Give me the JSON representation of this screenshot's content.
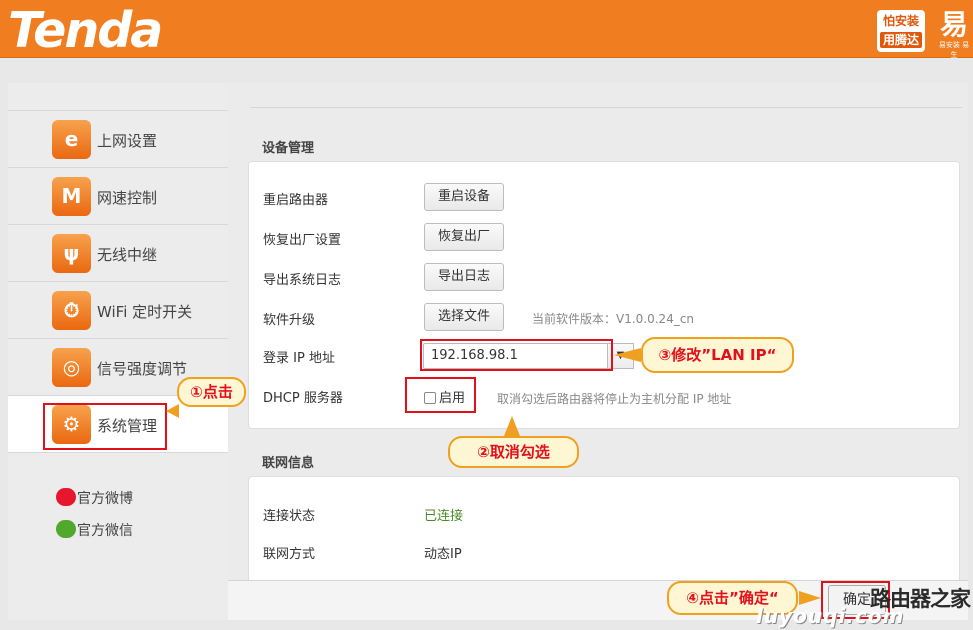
{
  "brand": {
    "logo": "Tenda",
    "stamp_line1": "怕安装",
    "stamp_line2": "用腾达",
    "easy_mark": "易",
    "easy_caption": "易安装 易生"
  },
  "sidebar": {
    "items": [
      {
        "label": "上网设置",
        "icon": "internet-e-icon",
        "glyph": "e"
      },
      {
        "label": "网速控制",
        "icon": "speed-wave-icon",
        "glyph": "M"
      },
      {
        "label": "无线中继",
        "icon": "wireless-relay-icon",
        "glyph": "ψ"
      },
      {
        "label": "WiFi 定时开关",
        "icon": "wifi-timer-icon",
        "glyph": "⏱"
      },
      {
        "label": "信号强度调节",
        "icon": "signal-strength-icon",
        "glyph": "◎"
      },
      {
        "label": "系统管理",
        "icon": "gear-icon",
        "glyph": "⚙"
      }
    ],
    "active_index": 5,
    "weibo": "官方微博",
    "wechat": "官方微信"
  },
  "device_mgmt": {
    "title": "设备管理",
    "reboot_label": "重启路由器",
    "reboot_button": "重启设备",
    "restore_label": "恢复出厂设置",
    "restore_button": "恢复出厂",
    "export_label": "导出系统日志",
    "export_button": "导出日志",
    "upgrade_label": "软件升级",
    "upgrade_button": "选择文件",
    "firmware_hint": "当前软件版本：V1.0.0.24_cn",
    "login_ip_label": "登录 IP 地址",
    "login_ip_value": "192.168.98.1",
    "dhcp_label": "DHCP 服务器",
    "dhcp_checkbox": "启用",
    "dhcp_enabled": false,
    "dhcp_hint": "取消勾选后路由器将停止为主机分配 IP 地址"
  },
  "wan_info": {
    "title": "联网信息",
    "status_label": "连接状态",
    "status_value": "已连接",
    "method_label": "联网方式",
    "method_value": "动态IP"
  },
  "footer": {
    "confirm": "确定"
  },
  "annotations": {
    "step1": "①点击",
    "step2": "②取消勾选",
    "step3": "③修改”LAN IP“",
    "step4": "④点击”确定“",
    "watermark": "路由器之家",
    "watermark_url": "luyouqi.com"
  },
  "colors": {
    "brand_orange": "#f07d1f",
    "annotation_red": "#e2101a",
    "callout_border": "#f0a020",
    "connected_green": "#4a8a2a"
  }
}
